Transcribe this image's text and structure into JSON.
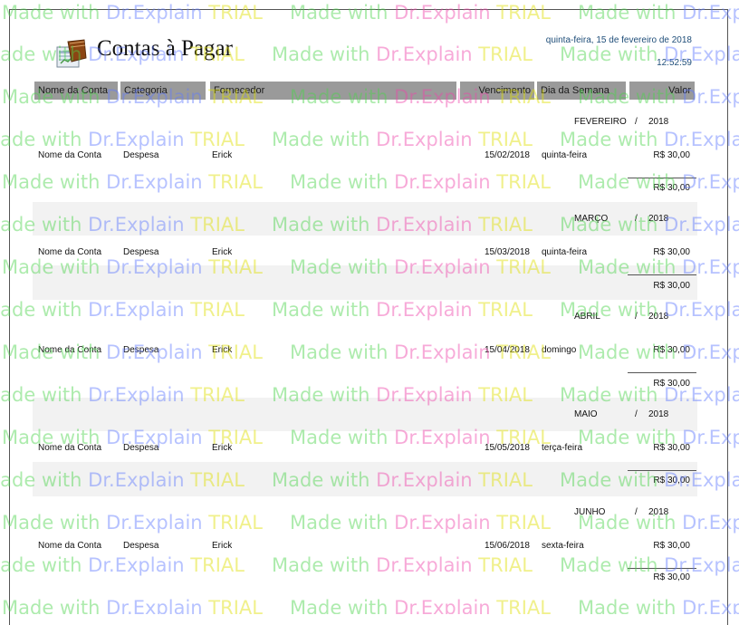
{
  "report": {
    "title": "Contas à Pagar",
    "date": "quinta-feira, 15 de fevereiro de 2018",
    "time": "12:52:59",
    "icon": "ledger-book-icon"
  },
  "columns": [
    "Nome da Conta",
    "Categoria",
    "Fornecedor",
    "Vencimento",
    "Dia da Semana",
    "Valor"
  ],
  "groups": [
    {
      "month": "FEVEREIRO",
      "sep": "/",
      "year": "2018",
      "row": {
        "nome": "Nome da Conta",
        "categoria": "Despesa",
        "fornecedor": "Erick",
        "vencimento": "15/02/2018",
        "dia": "quinta-feira",
        "valor": "R$ 30,00"
      },
      "total": "R$ 30,00"
    },
    {
      "month": "MARÇO",
      "sep": "/",
      "year": "2018",
      "row": {
        "nome": "Nome da Conta",
        "categoria": "Despesa",
        "fornecedor": "Erick",
        "vencimento": "15/03/2018",
        "dia": "quinta-feira",
        "valor": "R$ 30,00"
      },
      "total": "R$ 30,00"
    },
    {
      "month": "ABRIL",
      "sep": "/",
      "year": "2018",
      "row": {
        "nome": "Nome da Conta",
        "categoria": "Despesa",
        "fornecedor": "Erick",
        "vencimento": "15/04/2018",
        "dia": "domingo",
        "valor": "R$ 30,00"
      },
      "total": "R$ 30,00"
    },
    {
      "month": "MAIO",
      "sep": "/",
      "year": "2018",
      "row": {
        "nome": "Nome da Conta",
        "categoria": "Despesa",
        "fornecedor": "Erick",
        "vencimento": "15/05/2018",
        "dia": "terça-feira",
        "valor": "R$ 30,00"
      },
      "total": "R$ 30,00"
    },
    {
      "month": "JUNHO",
      "sep": "/",
      "year": "2018",
      "row": {
        "nome": "Nome da Conta",
        "categoria": "Despesa",
        "fornecedor": "Erick",
        "vencimento": "15/06/2018",
        "dia": "sexta-feira",
        "valor": "R$ 30,00"
      },
      "total": "R$ 30,00"
    }
  ],
  "watermark": {
    "part1": "Made with ",
    "part2": "Dr.Explain",
    "part3": " TRIAL"
  }
}
